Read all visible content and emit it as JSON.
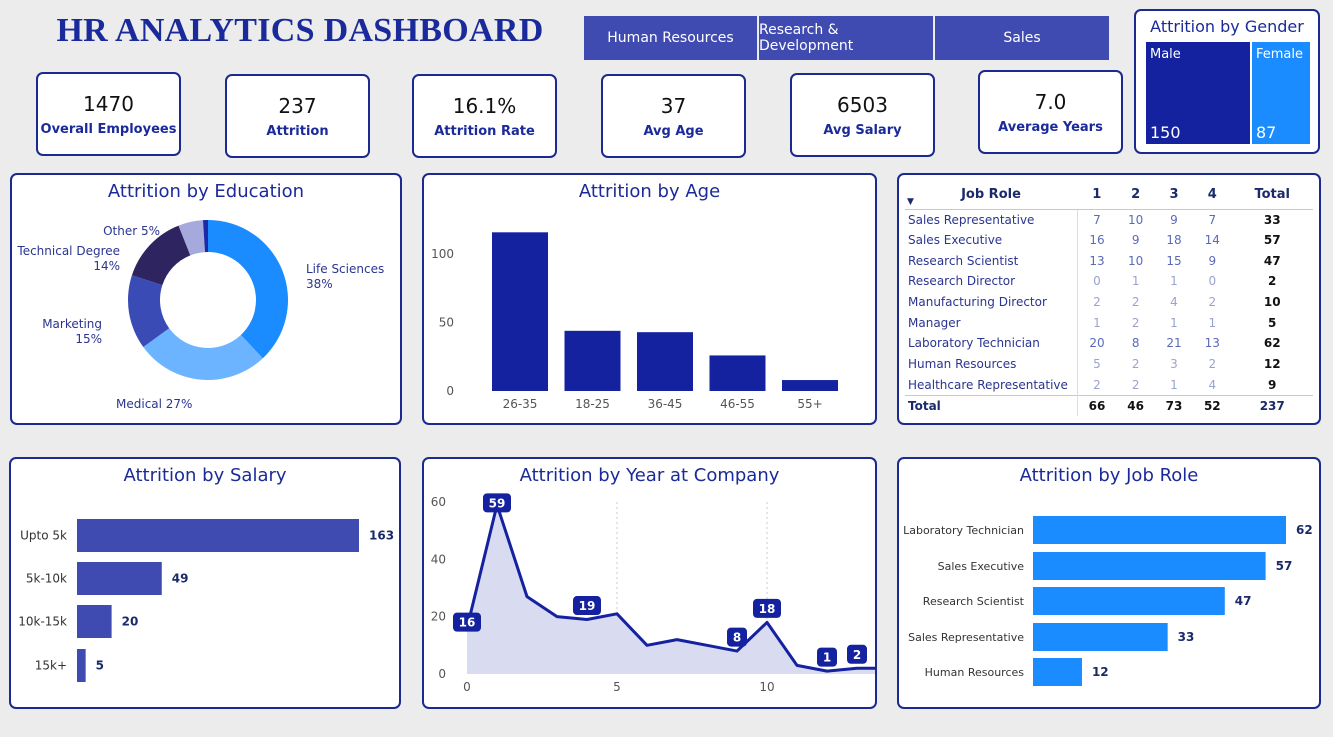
{
  "title": "HR ANALYTICS DASHBOARD",
  "departments": [
    "Human Resources",
    "Research & Development",
    "Sales"
  ],
  "kpis": [
    {
      "value": "1470",
      "label": "Overall Employees"
    },
    {
      "value": "237",
      "label": "Attrition"
    },
    {
      "value": "16.1%",
      "label": "Attrition Rate"
    },
    {
      "value": "37",
      "label": "Avg Age"
    },
    {
      "value": "6503",
      "label": "Avg Salary"
    },
    {
      "value": "7.0",
      "label": "Average Years"
    }
  ],
  "gender": {
    "title": "Attrition by Gender",
    "male_label": "Male",
    "male_value": "150",
    "female_label": "Female",
    "female_value": "87",
    "male_color": "#1422a0",
    "female_color": "#1a8cff"
  },
  "education": {
    "title": "Attrition by Education",
    "chart_data": {
      "type": "pie",
      "categories": [
        "Life Sciences",
        "Medical",
        "Marketing",
        "Technical Degree",
        "Other",
        "Human Resources"
      ],
      "values": [
        38,
        27,
        15,
        14,
        5,
        1
      ],
      "labels": [
        "Life Sciences\n38%",
        "Medical 27%",
        "Marketing\n15%",
        "Technical Degree\n14%",
        "Other 5%",
        ""
      ],
      "colors": [
        "#1a8cff",
        "#6cb4ff",
        "#3a4bb5",
        "#2e2460",
        "#a5a9dc",
        "#1a2aa8"
      ]
    }
  },
  "age": {
    "title": "Attrition by Age",
    "chart_data": {
      "type": "bar",
      "categories": [
        "26-35",
        "18-25",
        "36-45",
        "46-55",
        "55+"
      ],
      "values": [
        116,
        44,
        43,
        26,
        8
      ],
      "yticks": [
        0,
        50,
        100
      ],
      "ylim": [
        0,
        125
      ],
      "color": "#1422a0"
    }
  },
  "jobtable": {
    "headers": [
      "Job Role",
      "1",
      "2",
      "3",
      "4",
      "Total"
    ],
    "rows": [
      [
        "Sales Representative",
        "7",
        "10",
        "9",
        "7",
        "33"
      ],
      [
        "Sales Executive",
        "16",
        "9",
        "18",
        "14",
        "57"
      ],
      [
        "Research Scientist",
        "13",
        "10",
        "15",
        "9",
        "47"
      ],
      [
        "Research Director",
        "0",
        "1",
        "1",
        "0",
        "2"
      ],
      [
        "Manufacturing Director",
        "2",
        "2",
        "4",
        "2",
        "10"
      ],
      [
        "Manager",
        "1",
        "2",
        "1",
        "1",
        "5"
      ],
      [
        "Laboratory Technician",
        "20",
        "8",
        "21",
        "13",
        "62"
      ],
      [
        "Human Resources",
        "5",
        "2",
        "3",
        "2",
        "12"
      ],
      [
        "Healthcare Representative",
        "2",
        "2",
        "1",
        "4",
        "9"
      ]
    ],
    "total": [
      "Total",
      "66",
      "46",
      "73",
      "52",
      "237"
    ]
  },
  "salary": {
    "title": "Attrition by Salary",
    "chart_data": {
      "type": "bar",
      "orientation": "horizontal",
      "categories": [
        "Upto 5k",
        "5k-10k",
        "10k-15k",
        "15k+"
      ],
      "values": [
        163,
        49,
        20,
        5
      ],
      "color": "#3f4bb0"
    }
  },
  "years": {
    "title": "Attrition by Year at Company",
    "chart_data": {
      "type": "area",
      "x": [
        0,
        1,
        2,
        3,
        4,
        5,
        6,
        7,
        8,
        9,
        10,
        11,
        12,
        13,
        14
      ],
      "values": [
        16,
        59,
        27,
        20,
        19,
        21,
        10,
        12,
        10,
        8,
        18,
        3,
        1,
        2,
        2
      ],
      "xticks": [
        0,
        5,
        10
      ],
      "yticks": [
        0,
        20,
        40,
        60
      ],
      "ylim": [
        0,
        60
      ],
      "labeled_points": [
        0,
        1,
        4,
        9,
        10,
        12,
        13
      ],
      "line_color": "#1422a0",
      "fill_color": "#d9dbf0"
    }
  },
  "jobrole": {
    "title": "Attrition by Job Role",
    "chart_data": {
      "type": "bar",
      "orientation": "horizontal",
      "categories": [
        "Laboratory Technician",
        "Sales Executive",
        "Research Scientist",
        "Sales Representative",
        "Human Resources"
      ],
      "values": [
        62,
        57,
        47,
        33,
        12
      ],
      "color": "#1a8cff"
    }
  }
}
